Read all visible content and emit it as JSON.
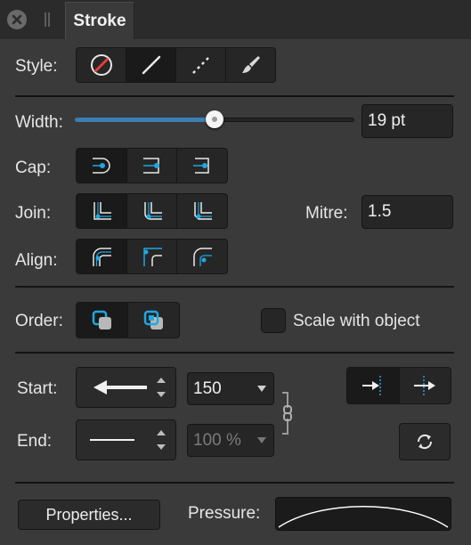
{
  "panel": {
    "tab_title": "Stroke"
  },
  "style": {
    "label": "Style:",
    "options": [
      {
        "name": "none",
        "icon": "no-stroke-icon",
        "selected": false
      },
      {
        "name": "solid",
        "icon": "solid-line-icon",
        "selected": true
      },
      {
        "name": "dashed",
        "icon": "dashed-line-icon",
        "selected": false
      },
      {
        "name": "brush",
        "icon": "brush-icon",
        "selected": false
      }
    ]
  },
  "width": {
    "label": "Width:",
    "value": "19 pt",
    "slider_fraction": 0.5
  },
  "cap": {
    "label": "Cap:",
    "options": [
      "butt-cap-icon",
      "round-cap-icon",
      "square-cap-icon"
    ],
    "selected": 0
  },
  "join": {
    "label": "Join:",
    "options": [
      "miter-join-icon",
      "round-join-icon",
      "bevel-join-icon"
    ],
    "selected": 0
  },
  "mitre": {
    "label": "Mitre:",
    "value": "1.5"
  },
  "align": {
    "label": "Align:",
    "options": [
      "align-center-icon",
      "align-inside-icon",
      "align-outside-icon"
    ],
    "selected": 0
  },
  "order": {
    "label": "Order:",
    "options": [
      "stroke-behind-fill-icon",
      "stroke-in-front-icon"
    ],
    "selected": 0
  },
  "scale_with_object": {
    "label": "Scale with object",
    "checked": false
  },
  "start": {
    "label": "Start:",
    "arrowhead_icon": "arrow-left-icon",
    "size": "150"
  },
  "end": {
    "label": "End:",
    "arrowhead_icon": "line-end-none-icon",
    "size": "100 %"
  },
  "arrow_position": {
    "options": [
      "arrow-outside-end-icon",
      "arrow-inside-end-icon"
    ],
    "selected": 0
  },
  "swap": {
    "icon": "swap-arrows-icon"
  },
  "properties": {
    "label": "Properties..."
  },
  "pressure": {
    "label": "Pressure:"
  },
  "colors": {
    "accent": "#1ea7e1",
    "slider_fill": "#3b7fb4",
    "panel": "#3a3a3a",
    "no_stroke": "#e0413a"
  }
}
